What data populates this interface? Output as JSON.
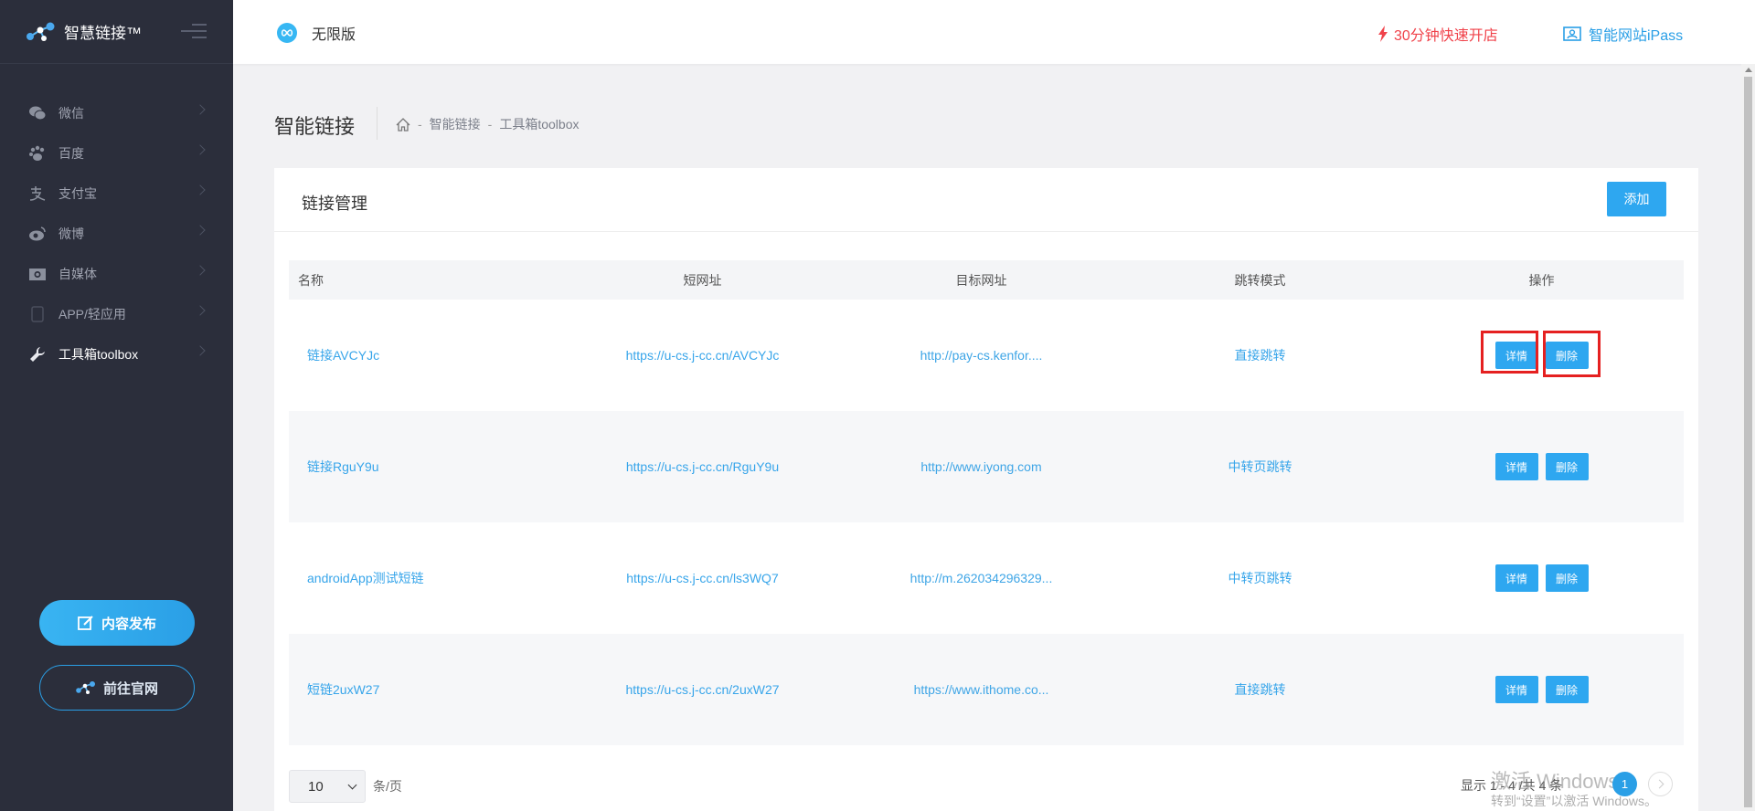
{
  "app": {
    "name": "智慧链接™"
  },
  "header": {
    "edition": "无限版",
    "quick_open": "30分钟快速开店",
    "ipass": "智能网站iPass"
  },
  "sidebar": {
    "items": [
      {
        "label": "微信",
        "icon": "wechat-icon"
      },
      {
        "label": "百度",
        "icon": "baidu-paw-icon"
      },
      {
        "label": "支付宝",
        "icon": "alipay-icon"
      },
      {
        "label": "微博",
        "icon": "weibo-icon"
      },
      {
        "label": "自媒体",
        "icon": "media-icon"
      },
      {
        "label": "APP/轻应用",
        "icon": "app-icon"
      },
      {
        "label": "工具箱toolbox",
        "icon": "wrench-icon",
        "active": true
      }
    ],
    "publish_btn": "内容发布",
    "official_btn": "前往官网"
  },
  "page": {
    "title": "智能链接",
    "breadcrumb": [
      "智能链接",
      "工具箱toolbox"
    ]
  },
  "card": {
    "title": "链接管理",
    "add_label": "添加"
  },
  "table": {
    "columns": [
      "名称",
      "短网址",
      "目标网址",
      "跳转模式",
      "操作"
    ],
    "rows": [
      {
        "name": "链接AVCYJc",
        "short": "https://u-cs.j-cc.cn/AVCYJc",
        "target": "http://pay-cs.kenfor....",
        "mode": "直接跳转"
      },
      {
        "name": "链接RguY9u",
        "short": "https://u-cs.j-cc.cn/RguY9u",
        "target": "http://www.iyong.com",
        "mode": "中转页跳转"
      },
      {
        "name": "androidApp测试短链",
        "short": "https://u-cs.j-cc.cn/ls3WQ7",
        "target": "http://m.262034296329...",
        "mode": "中转页跳转"
      },
      {
        "name": "短链2uxW27",
        "short": "https://u-cs.j-cc.cn/2uxW27",
        "target": "https://www.ithome.co...",
        "mode": "直接跳转"
      }
    ],
    "detail_label": "详情",
    "delete_label": "删除"
  },
  "pagination": {
    "page_size": "10",
    "per_page_label": "条/页",
    "showing": "显示 1 - 4 /共 4 条",
    "current_page": "1"
  },
  "watermark": {
    "line1": "激活 Windows",
    "line2": "转到“设置”以激活 Windows。"
  },
  "colors": {
    "accent": "#2ea7f0",
    "sidebar": "#2b2e3b",
    "danger": "#f0434b",
    "highlight": "#e52020"
  }
}
